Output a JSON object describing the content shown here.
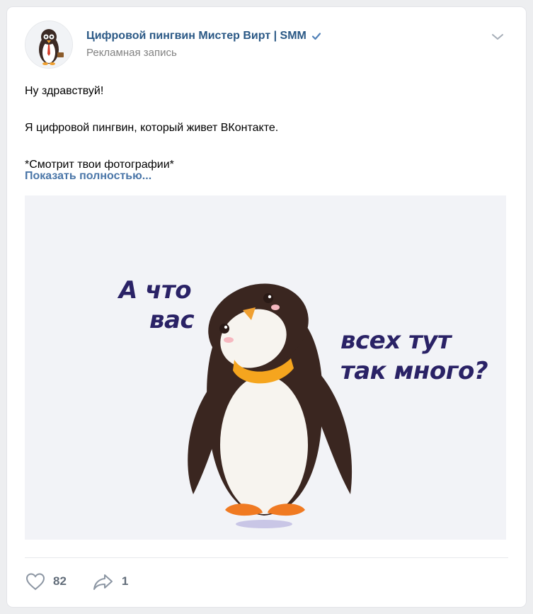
{
  "post": {
    "author": "Цифровой пингвин Мистер Вирт | SMM",
    "subtitle": "Рекламная запись",
    "text": [
      "Ну здравствуй!",
      "Я цифровой пингвин, который живет ВКонтакте.",
      "*Смотрит твои фотографии*"
    ],
    "show_more": "Показать полностью..."
  },
  "media": {
    "caption_left": [
      "А что",
      "вас"
    ],
    "caption_right": [
      "всех тут",
      "так много?"
    ]
  },
  "actions": {
    "likes": "82",
    "shares": "1"
  },
  "icons": {
    "verified": "verified-check-icon",
    "menu": "chevron-down-icon",
    "like": "heart-icon",
    "share": "share-arrow-icon"
  },
  "colors": {
    "link": "#2a5885",
    "show_more": "#4a76a8",
    "muted": "#828282",
    "verified": "#5181b8",
    "caption": "#2a2266"
  }
}
